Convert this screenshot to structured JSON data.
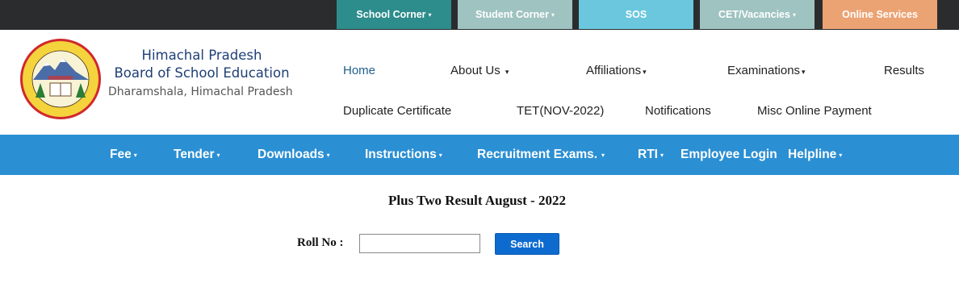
{
  "top_tabs": [
    {
      "label": "School Corner",
      "caret": "▾",
      "color": "#2d8c8c"
    },
    {
      "label": "Student Corner",
      "caret": "▾",
      "color": "#9fc3c1"
    },
    {
      "label": "SOS",
      "caret": "",
      "color": "#6ac7dd"
    },
    {
      "label": "CET/Vacancies",
      "caret": "▾",
      "color": "#9fc3c1"
    },
    {
      "label": "Online Services",
      "caret": "",
      "color": "#eca374"
    }
  ],
  "brand": {
    "line1": "Himachal Pradesh",
    "line2": "Board of School Education",
    "line3": "Dharamshala, Himachal Pradesh",
    "logo_icon": "board-seal-logo"
  },
  "nav": {
    "home": "Home",
    "about": "About Us",
    "affiliations": "Affiliations",
    "examinations": "Examinations",
    "results": "Results",
    "duplicate": "Duplicate Certificate",
    "tet": "TET(NOV-2022)",
    "notifications": "Notifications",
    "misc": "Misc Online Payment",
    "caret": "▾"
  },
  "menu": {
    "fee": "Fee",
    "tender": "Tender",
    "downloads": "Downloads",
    "instructions": "Instructions",
    "recruitment": "Recruitment Exams.",
    "rti": "RTI",
    "employee": "Employee Login",
    "helpline": "Helpline",
    "caret": "▾"
  },
  "content": {
    "title": "Plus Two Result August - 2022",
    "roll_label": "Roll No :",
    "roll_value": "",
    "search_label": "Search"
  },
  "colors": {
    "topbar_bg": "#2b2c2e",
    "menu_bg": "#2b8fd3",
    "brand_text": "#1f3f76",
    "button_bg": "#0d6bd0"
  }
}
